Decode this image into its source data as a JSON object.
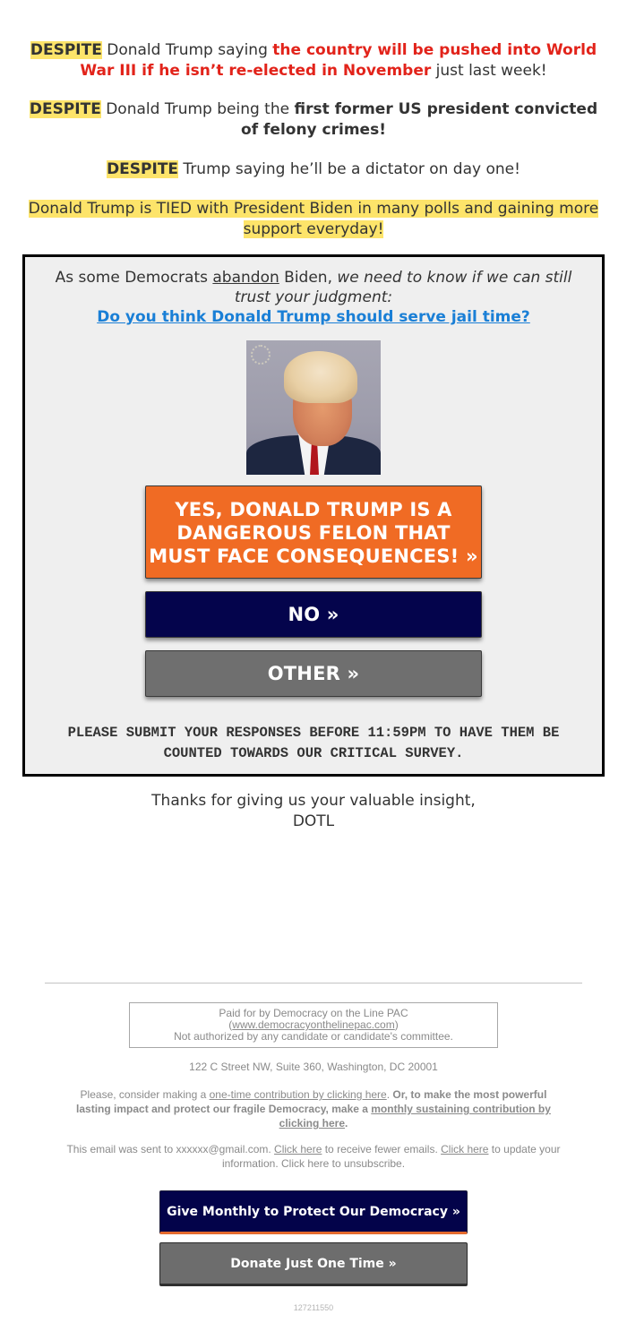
{
  "intro": {
    "p1": {
      "despite": "DESPITE",
      "pre": " Donald Trump saying ",
      "emph": "the country will be pushed into World War III if he isn’t re-elected in November",
      "post": " just last week!"
    },
    "p2": {
      "despite": "DESPITE",
      "pre": " Donald Trump being the ",
      "emph": "first former US president convicted of felony crimes!"
    },
    "p3": {
      "despite": "DESPITE",
      "post": " Trump saying he’ll be a dictator on day one!"
    },
    "p4": {
      "text": "Donald Trump is TIED with President Biden in many polls and gaining more support everyday!"
    }
  },
  "survey": {
    "lead_pre": "As some Democrats ",
    "lead_underlined": "abandon",
    "lead_mid": " Biden, ",
    "lead_italic": "we need to know if we can still trust your judgment:",
    "question": "Do you think Donald Trump should serve jail time?",
    "image_alt": "Donald Trump mugshot",
    "buttons": {
      "yes": "YES, DONALD TRUMP IS A DANGEROUS FELON THAT MUST FACE CONSEQUENCES! »",
      "no": "NO »",
      "other": "OTHER »"
    },
    "deadline": "PLEASE SUBMIT YOUR RESPONSES BEFORE 11:59PM TO HAVE THEM BE COUNTED TOWARDS OUR CRITICAL SURVEY."
  },
  "signoff": {
    "line1": "Thanks for giving us your valuable insight,",
    "line2": "DOTL"
  },
  "footer": {
    "paid_for": "Paid for by Democracy on the Line PAC",
    "website": "www.democracyonthelinepac.com",
    "not_authorized": "Not authorized by any candidate or candidate's committee.",
    "address": "122 C Street NW, Suite 360, Washington, DC 20001",
    "contrib_pre": "Please, consider making a ",
    "contrib_link1": "one-time contribution by clicking here",
    "contrib_mid": ". ",
    "contrib_bold": "Or, to make the most powerful lasting impact and protect our fragile Democracy, make a ",
    "contrib_link2": "monthly sustaining contribution by clicking here",
    "contrib_end": ".",
    "sent_pre": "This email was sent to xxxxxx@gmail.com. ",
    "sent_link1": "Click here",
    "sent_mid1": " to receive fewer emails. ",
    "sent_link2": "Click here",
    "sent_mid2": " to update your information. Click here to unsubscribe.",
    "btn_monthly": "Give Monthly to Protect Our Democracy »",
    "btn_once": "Donate Just One Time »",
    "email_id": "127211550"
  },
  "colors": {
    "highlight": "#fde46a",
    "red_emphasis": "#e2231a",
    "link_blue": "#1a7fd6",
    "yes_orange": "#f06b24",
    "no_navy": "#04044c",
    "other_gray": "#6f6f6f"
  }
}
